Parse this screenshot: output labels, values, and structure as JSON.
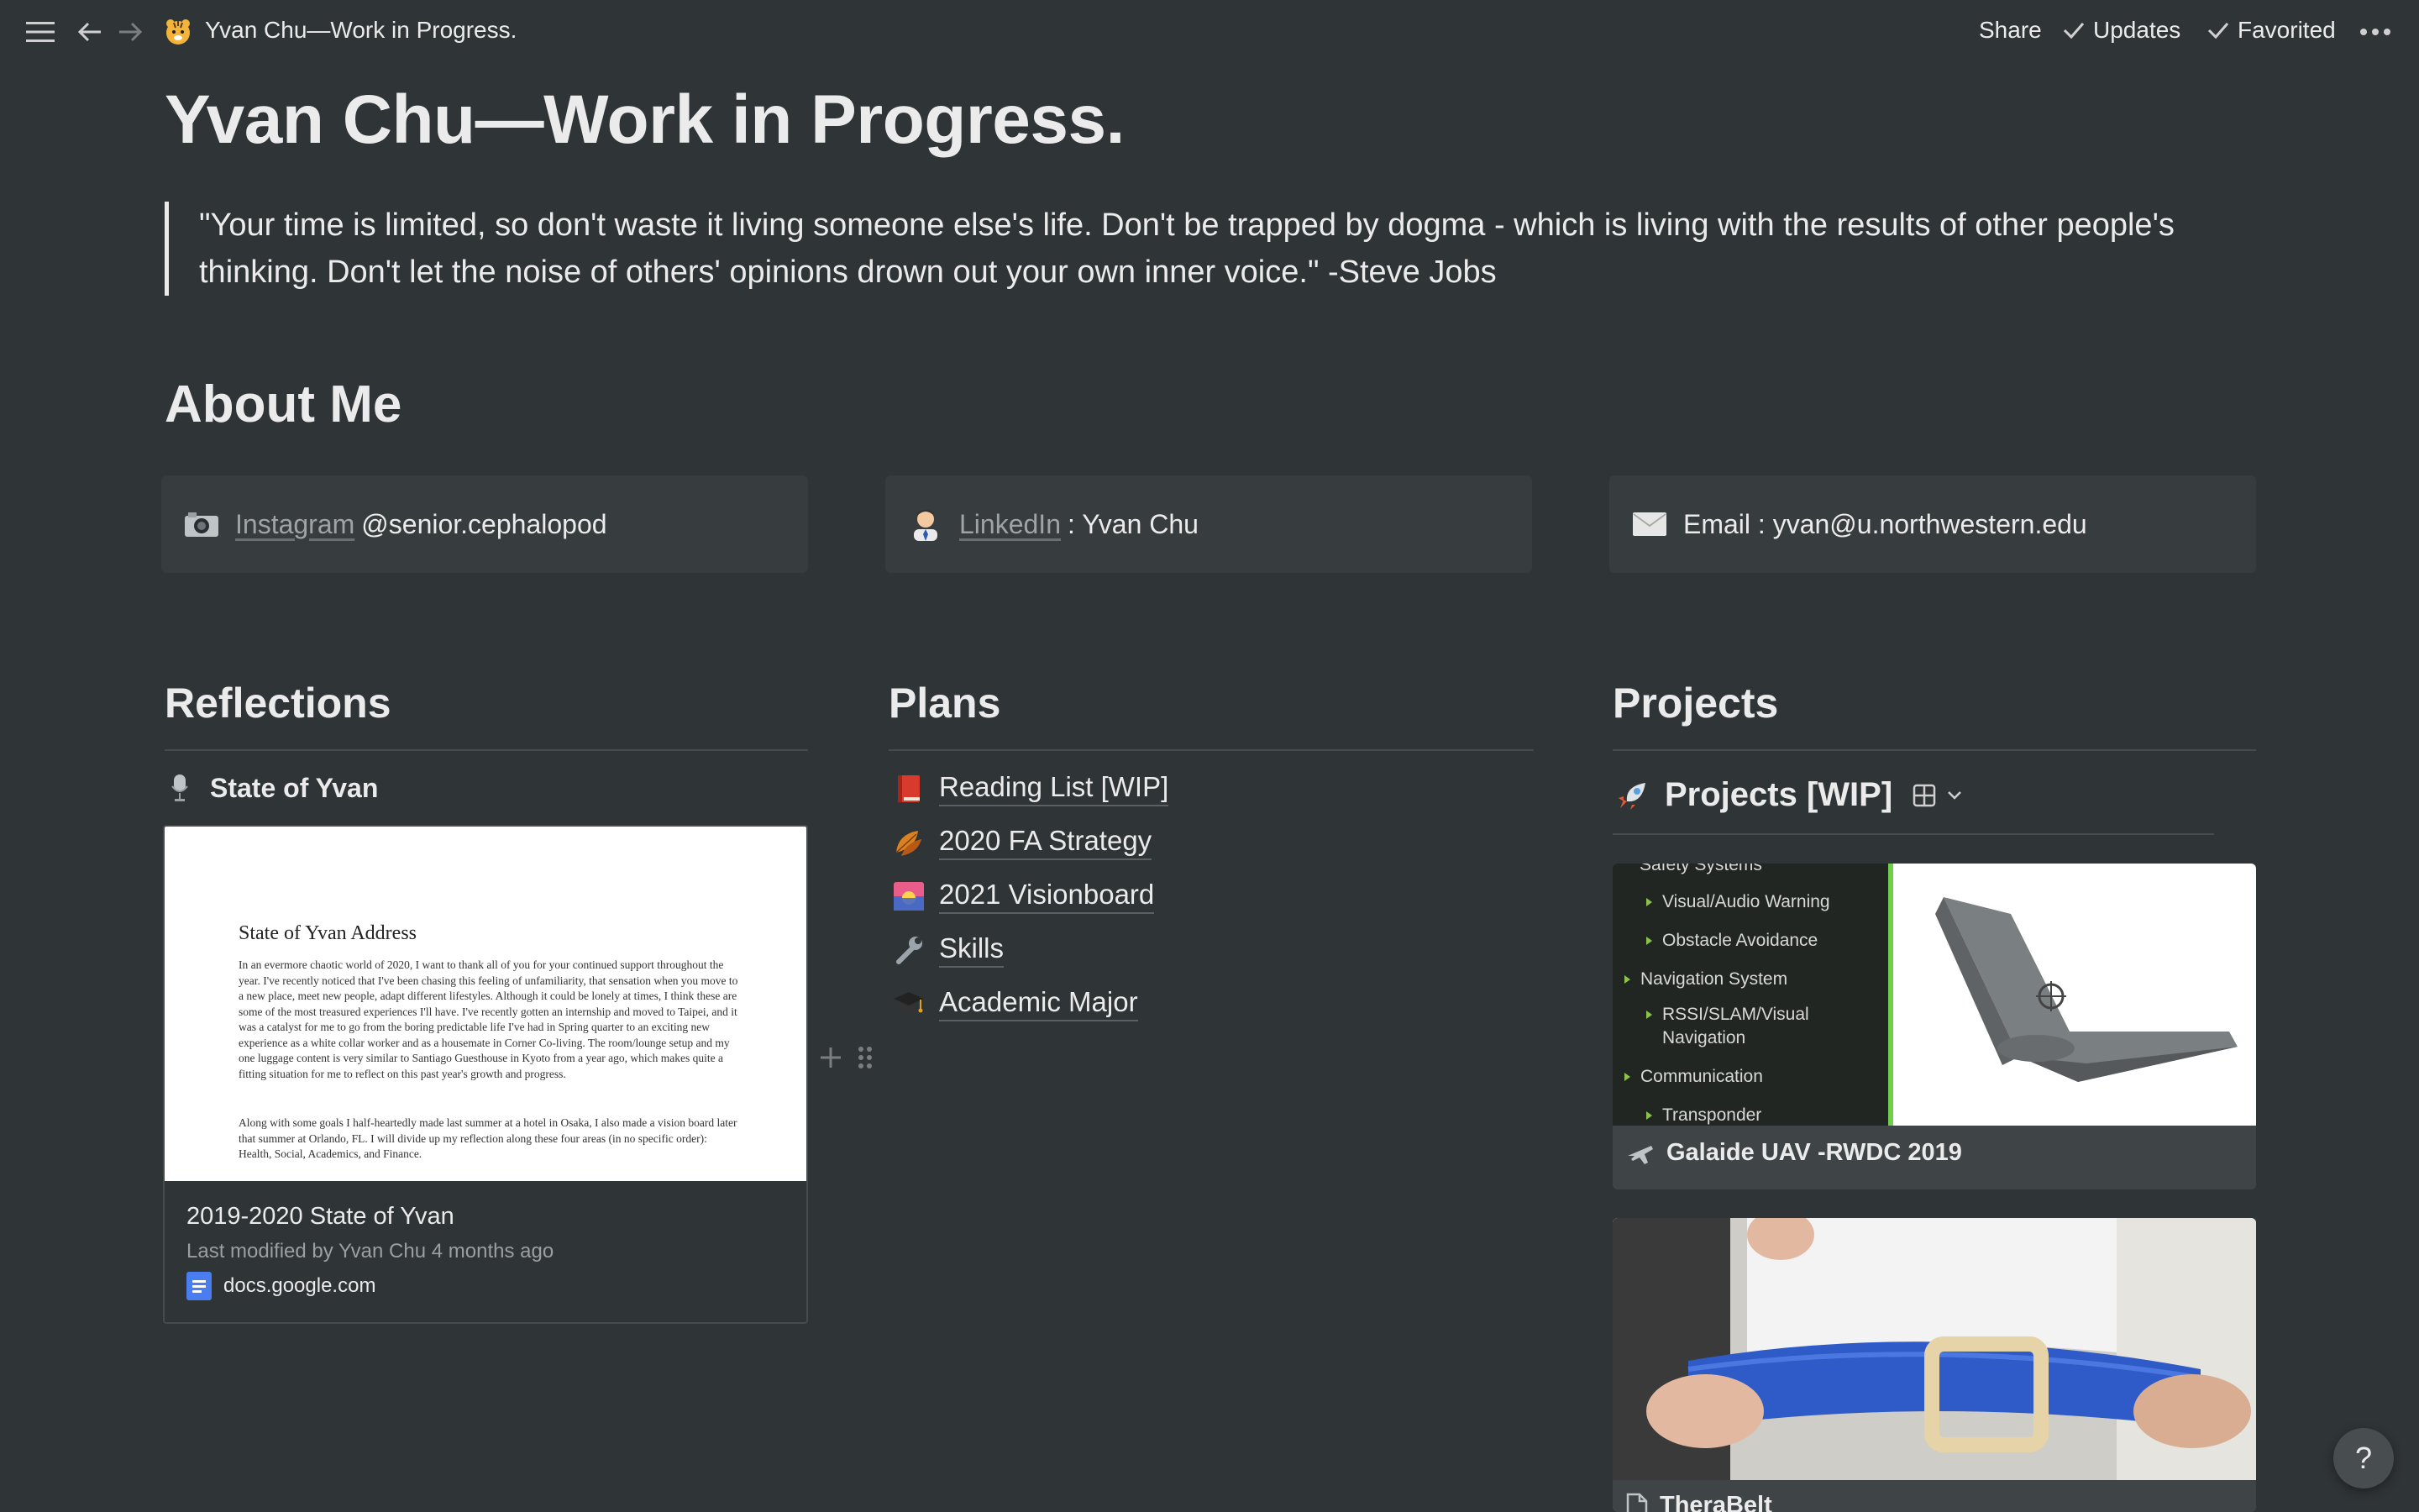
{
  "topbar": {
    "breadcrumb_title": "Yvan Chu—Work in Progress.",
    "share_label": "Share",
    "updates_label": "Updates",
    "favorited_label": "Favorited"
  },
  "page": {
    "title": "Yvan Chu—Work in Progress.",
    "quote_line1": "\"Your time is limited, so don't waste it living someone else's life. Don't be trapped by dogma - which is living with the results of other people's",
    "quote_line2": "thinking. Don't let the noise of others' opinions drown out your own inner voice.\" -Steve Jobs"
  },
  "about": {
    "heading": "About Me",
    "instagram_link": "Instagram",
    "instagram_handle": "@senior.cephalopod",
    "linkedin_link": "LinkedIn",
    "linkedin_text": ": Yvan Chu",
    "email_text": "Email : yvan@u.northwestern.edu"
  },
  "reflections": {
    "heading": "Reflections",
    "page_link": "State of Yvan",
    "bookmark": {
      "doc_title": "State of Yvan Address",
      "doc_para1": "In an evermore chaotic world of 2020, I want to thank all of you for your continued support throughout the year. I've recently noticed that I've been chasing this feeling of unfamiliarity, that sensation when you move to a new place, meet new people, adapt different lifestyles. Although it could be lonely at times, I think these are some of the most treasured experiences I'll have. I've recently gotten an internship and moved to Taipei, and it was a catalyst for me to go from the boring predictable life I've had in Spring quarter to an exciting new experience as a white collar worker and as a housemate in Corner Co-living. The room/lounge setup and my one luggage content is very similar to Santiago Guesthouse in Kyoto from a year ago, which makes quite a fitting situation for me to reflect on this past year's growth and progress.",
      "doc_para2": "Along with some goals I half-heartedly made last summer at a hotel in Osaka, I also made a vision board later that summer at Orlando, FL. I will divide up my reflection along these four areas (in no specific order): Health, Social, Academics, and Finance.",
      "title": "2019-2020 State of Yvan",
      "subtitle": "Last modified by Yvan Chu 4 months ago",
      "url": "docs.google.com"
    }
  },
  "plans": {
    "heading": "Plans",
    "items": [
      {
        "label": "Reading List [WIP]",
        "icon": "book-icon"
      },
      {
        "label": "2020 FA Strategy",
        "icon": "leaf-icon"
      },
      {
        "label": "2021 Visionboard",
        "icon": "sunrise-icon"
      },
      {
        "label": "Skills",
        "icon": "wrench-icon"
      },
      {
        "label": "Academic Major",
        "icon": "graduation-cap-icon"
      }
    ]
  },
  "projects": {
    "heading": "Projects",
    "db_title": "Projects [WIP]",
    "card1": {
      "title": "Galaide UAV -RWDC 2019",
      "tree": [
        "Safety Systems",
        "Visual/Audio Warning",
        "Obstacle Avoidance",
        "Navigation System",
        "RSSI/SLAM/Visual",
        "Navigation",
        "Communication",
        "Transponder"
      ]
    },
    "card2": {
      "title": "TheraBelt"
    }
  },
  "help_label": "?"
}
